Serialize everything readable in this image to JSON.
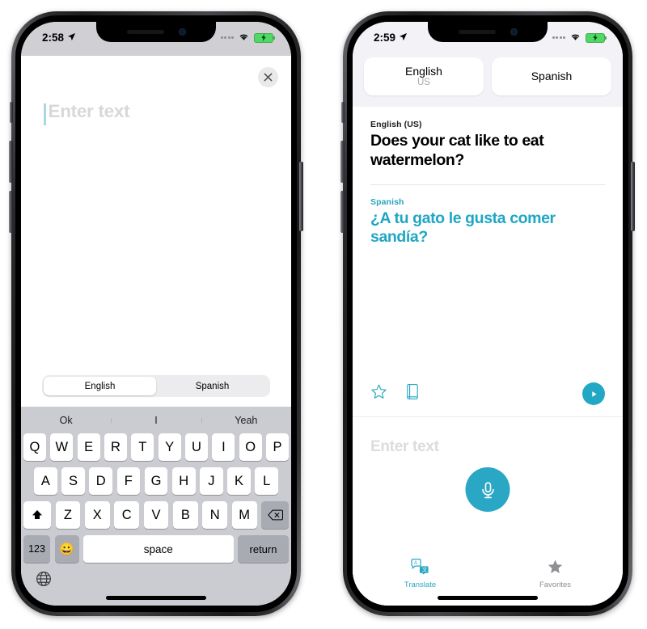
{
  "app": {
    "name": "Translate"
  },
  "left_phone": {
    "status_bar": {
      "time": "2:58",
      "location_icon": "location-arrow-icon",
      "cellular_icon": "cellular-dots-icon",
      "wifi_icon": "wifi-icon",
      "battery_icon": "battery-charging-icon"
    },
    "close_button": {
      "icon": "close-x-icon",
      "label": "Close"
    },
    "text_entry": {
      "value": "",
      "placeholder": "Enter text",
      "caret_visible": true
    },
    "language_segment": {
      "options": [
        {
          "label": "English",
          "selected": true
        },
        {
          "label": "Spanish",
          "selected": false
        }
      ]
    },
    "keyboard": {
      "predictions": [
        "Ok",
        "I",
        "Yeah"
      ],
      "row1": [
        "Q",
        "W",
        "E",
        "R",
        "T",
        "Y",
        "U",
        "I",
        "O",
        "P"
      ],
      "row2": [
        "A",
        "S",
        "D",
        "F",
        "G",
        "H",
        "J",
        "K",
        "L"
      ],
      "row3_letters": [
        "Z",
        "X",
        "C",
        "V",
        "B",
        "N",
        "M"
      ],
      "shift_key": {
        "icon": "shift-arrow-icon",
        "label": ""
      },
      "delete_key": {
        "icon": "backspace-icon",
        "label": ""
      },
      "numbers_key": "123",
      "emoji_key": {
        "icon": "emoji-smiley-icon",
        "label": "😀"
      },
      "space_key": "space",
      "return_key": "return",
      "globe_key": {
        "icon": "globe-icon",
        "label": ""
      }
    }
  },
  "right_phone": {
    "status_bar": {
      "time": "2:59",
      "location_icon": "location-arrow-icon",
      "cellular_icon": "cellular-dots-icon",
      "wifi_icon": "wifi-icon",
      "battery_icon": "battery-charging-icon"
    },
    "language_cards": {
      "source": {
        "name": "English",
        "region": "US"
      },
      "target": {
        "name": "Spanish",
        "region": ""
      }
    },
    "result": {
      "source_label": "English (US)",
      "source_text": "Does your cat like to eat watermelon?",
      "target_label": "Spanish",
      "target_text": "¿A tu gato le gusta comer sandía?"
    },
    "actions": {
      "favorite": {
        "icon": "star-outline-icon",
        "label": "Favorite"
      },
      "dictionary": {
        "icon": "dictionary-book-icon",
        "label": "Dictionary"
      },
      "play": {
        "icon": "play-icon",
        "label": "Play"
      }
    },
    "input_area": {
      "placeholder": "Enter text",
      "value": "",
      "mic_button": {
        "icon": "microphone-icon",
        "label": "Record"
      }
    },
    "tab_bar": {
      "tabs": [
        {
          "label": "Translate",
          "icon": "translate-icon",
          "active": true
        },
        {
          "label": "Favorites",
          "icon": "star-filled-icon",
          "active": false
        }
      ]
    }
  },
  "colors": {
    "accent_teal": "#2aa7c4",
    "translation_text": "#1fa6c4",
    "inactive_gray": "#8e8e93",
    "placeholder_gray": "#dcdce0",
    "keyboard_bg": "#cbccd2",
    "key_white": "#ffffff",
    "key_gray": "#a9abb3",
    "battery_green": "#4cd964"
  }
}
